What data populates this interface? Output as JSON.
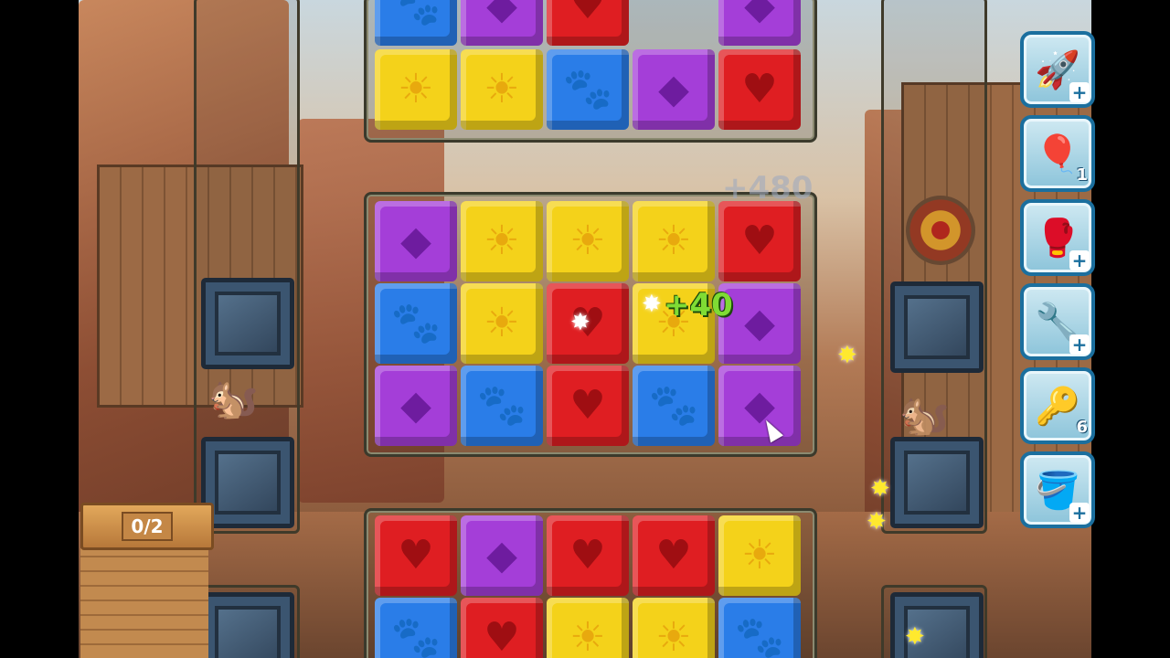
{
  "progress": {
    "counter": "0/2"
  },
  "score_popups": {
    "main": "+40",
    "faded": "+480"
  },
  "boosters": [
    {
      "icon": "rocket-icon",
      "count": "+",
      "glyph": "🚀"
    },
    {
      "icon": "balloons-icon",
      "count": "1",
      "glyph": "🎈"
    },
    {
      "icon": "boxing-glove-icon",
      "count": "+",
      "glyph": "🥊"
    },
    {
      "icon": "pliers-icon",
      "count": "+",
      "glyph": "🔧"
    },
    {
      "icon": "key-icon",
      "count": "6",
      "glyph": "🔑"
    },
    {
      "icon": "paint-bucket-icon",
      "count": "+",
      "glyph": "🪣"
    }
  ],
  "symbols": {
    "yellow": "☀",
    "blue": "🐾",
    "red": "♥",
    "purple": "◆"
  },
  "colors": {
    "yellow": "#f4d21a",
    "blue": "#2a7de8",
    "red": "#df1e22",
    "purple": "#a43ed8"
  },
  "boards": {
    "top": [
      [
        "blue",
        "purple",
        "red",
        "gap",
        "purple"
      ],
      [
        "yellow",
        "yellow",
        "blue",
        "purple",
        "red"
      ]
    ],
    "middle": [
      [
        "purple",
        "yellow",
        "yellow",
        "yellow",
        "red"
      ],
      [
        "blue",
        "yellow",
        "red",
        "yellow",
        "purple"
      ],
      [
        "purple",
        "blue",
        "red",
        "blue",
        "purple"
      ]
    ],
    "bottom": [
      [
        "red",
        "purple",
        "red",
        "red",
        "yellow"
      ],
      [
        "blue",
        "red",
        "yellow",
        "yellow",
        "blue"
      ]
    ]
  }
}
